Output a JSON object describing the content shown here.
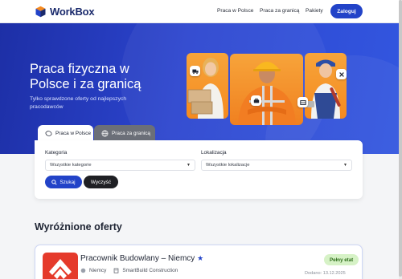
{
  "brand": {
    "name": "WorkBox"
  },
  "nav": {
    "links": [
      "Praca w Polsce",
      "Praca za granicą",
      "Pakiety"
    ],
    "login": "Zaloguj"
  },
  "hero": {
    "title": "Praca fizyczna w Polsce i za granicą",
    "subtitle": "Tylko sprawdzone oferty od najlepszych pracodawców"
  },
  "search": {
    "tabs": [
      "Praca w Polsce",
      "Praca za granicą"
    ],
    "active_tab": "Praca w Polsce",
    "category_label": "Kategoria",
    "category_value": "Wszystkie kategorie",
    "location_label": "Lokalizacja",
    "location_value": "Wszystkie lokalizacje",
    "search_button": "Szukaj",
    "clear_button": "Wyczyść"
  },
  "featured": {
    "title": "Wyróżnione oferty",
    "offers": [
      {
        "title": "Pracownik Budowlany – Niemcy",
        "country": "Niemcy",
        "company": "SmartBuild Construction",
        "type": "Pełny etat",
        "date": "Dodano: 13.12.2025"
      }
    ]
  },
  "colors": {
    "primary": "#2243c8",
    "hero_start": "#1d2fa6",
    "hero_end": "#3357e0",
    "accent_orange": "#f58a1f",
    "badge_green_bg": "#d6f2c6",
    "badge_green_text": "#2f6e1c"
  },
  "icons": [
    "logo-cube-icon",
    "truck-icon",
    "tools-icon",
    "wrench-icon",
    "box-icon",
    "flag-icon",
    "globe-icon",
    "search-icon",
    "star-icon",
    "flag-pl-icon",
    "building-icon"
  ]
}
